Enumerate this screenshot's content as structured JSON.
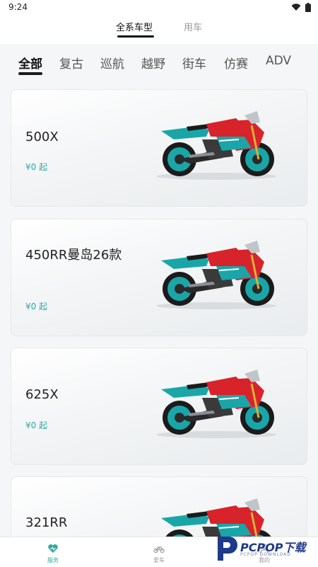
{
  "status": {
    "time": "9:24"
  },
  "top_tabs": [
    {
      "label": "全系车型",
      "active": true
    },
    {
      "label": "用车",
      "active": false
    }
  ],
  "categories": [
    {
      "label": "全部",
      "active": true
    },
    {
      "label": "复古"
    },
    {
      "label": "巡航"
    },
    {
      "label": "越野"
    },
    {
      "label": "街车"
    },
    {
      "label": "仿赛"
    },
    {
      "label": "ADV"
    }
  ],
  "cards": [
    {
      "title": "500X",
      "price": "¥0 起"
    },
    {
      "title": "450RR曼岛26款",
      "price": "¥0 起"
    },
    {
      "title": "625X",
      "price": "¥0 起"
    },
    {
      "title": "321RR",
      "price": ""
    }
  ],
  "bottom_nav": [
    {
      "label": "服务",
      "icon": "heart-service-icon",
      "active": true
    },
    {
      "label": "爱车",
      "icon": "motorcycle-icon",
      "active": false
    },
    {
      "label": "我的",
      "icon": "user-icon",
      "active": false
    }
  ],
  "watermark": {
    "brand": "PCPOP下载",
    "sub": "PCPOP DOWNLOAD"
  },
  "colors": {
    "accent": "#2ea9a2",
    "bike_red": "#d8232a",
    "bike_teal": "#1aa6a8"
  }
}
